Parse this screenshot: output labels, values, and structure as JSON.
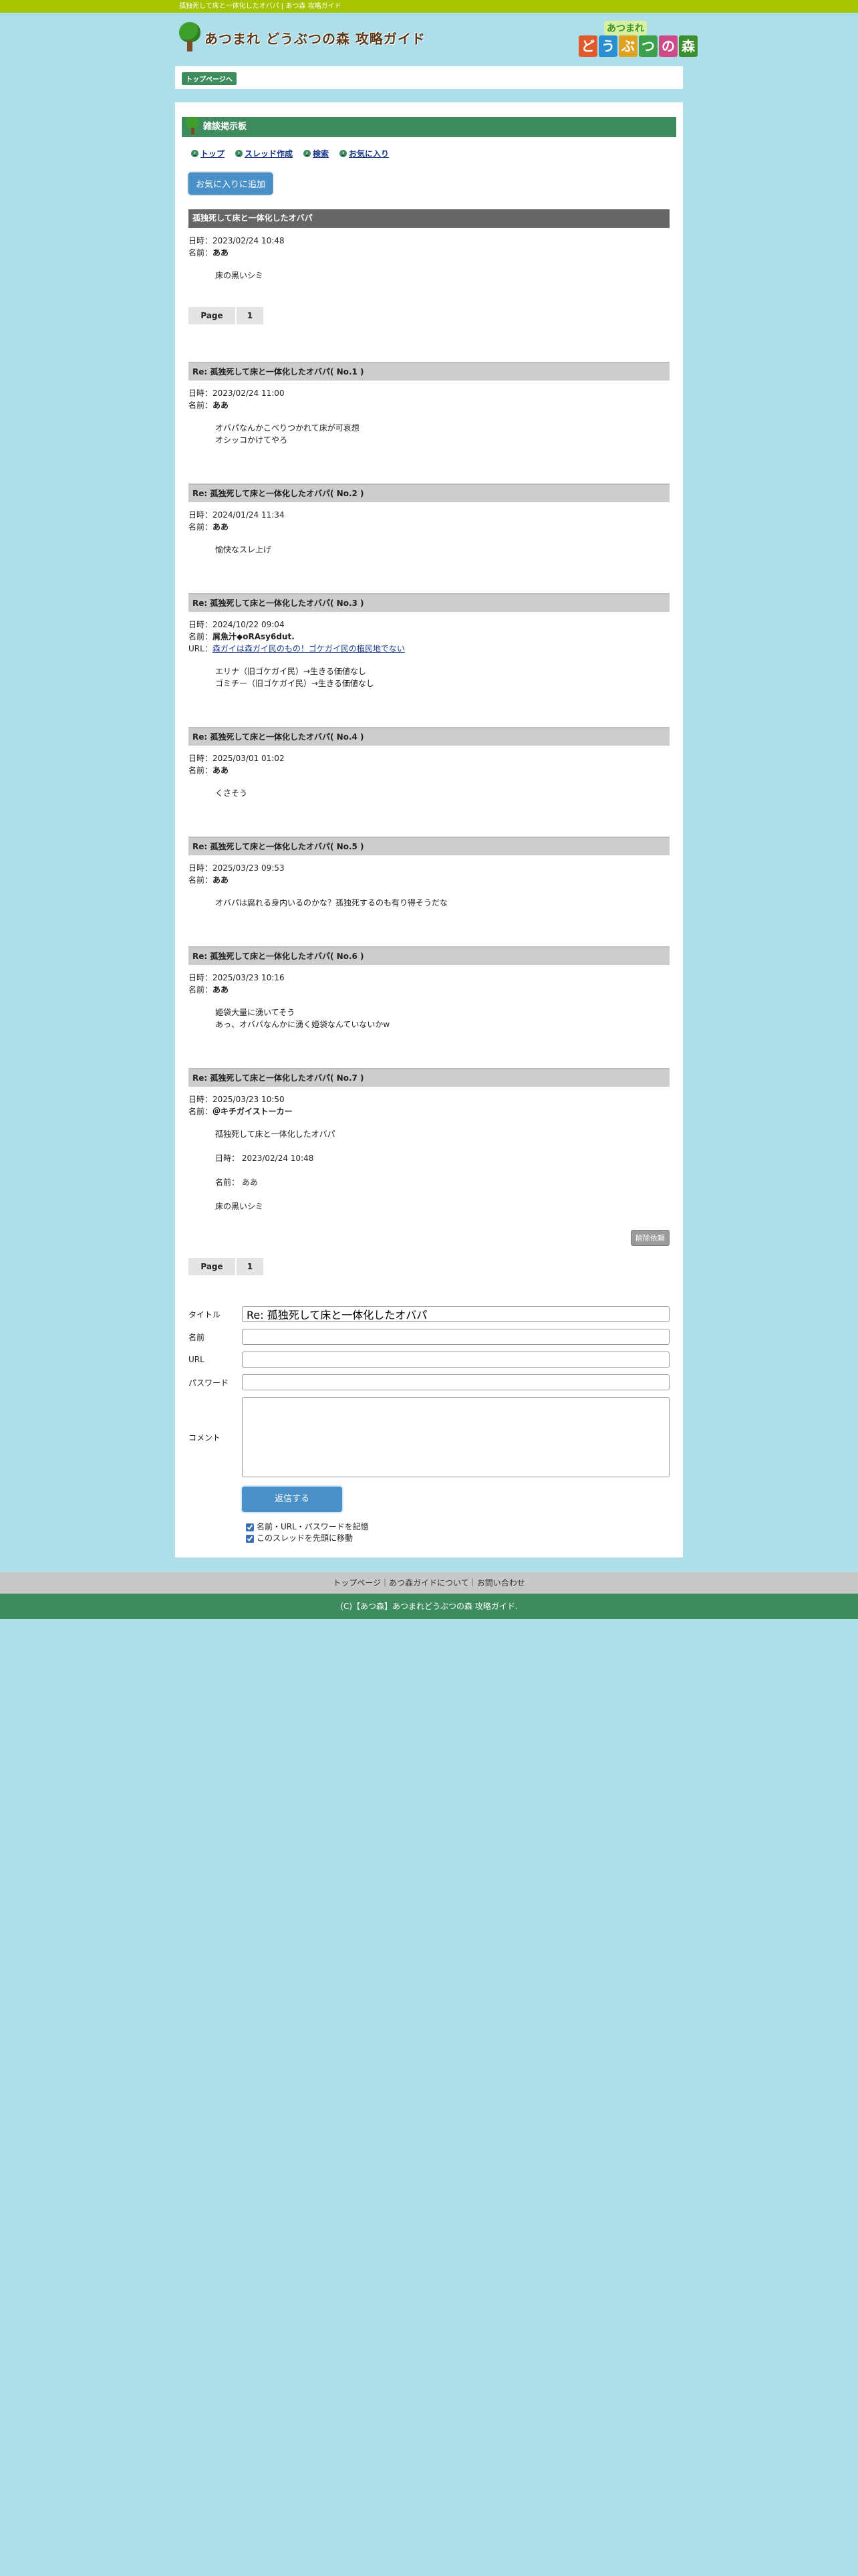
{
  "topbar": {
    "title": "孤独死して床と一体化したオバパ | あつ森 攻略ガイド"
  },
  "header": {
    "logo_text": "あつまれ どうぶつの森 攻略ガイド",
    "logo2_small": "あつまれ",
    "logo2_tiles": [
      "ど",
      "う",
      "ぶ",
      "つ",
      "の",
      "森"
    ]
  },
  "breadcrumb": {
    "home": "トップページへ"
  },
  "board": {
    "title": "雑談掲示板"
  },
  "nav": {
    "top": "トップ",
    "new_thread": "スレッド作成",
    "search": "検索",
    "favorites": "お気に入り"
  },
  "fav_button": "お気に入りに追加",
  "labels": {
    "date": "日時：",
    "name": "名前：",
    "url": "URL：",
    "page": "Page",
    "delete": "削除依頼"
  },
  "original": {
    "title": "孤独死して床と一体化したオバパ",
    "date": "2023/02/24 10:48",
    "name": "ああ",
    "body": "床の黒いシミ"
  },
  "pager_top": {
    "label": "Page",
    "num": "1"
  },
  "replies": [
    {
      "title": "Re: 孤独死して床と一体化したオバパ( No.1 )",
      "date": "2023/02/24 11:00",
      "name": "ああ",
      "body": [
        "オバパなんかこべりつかれて床が可哀想",
        "オシッコかけてやろ"
      ]
    },
    {
      "title": "Re: 孤独死して床と一体化したオバパ( No.2 )",
      "date": "2024/01/24 11:34",
      "name": "ああ",
      "body": [
        "愉快なスレ上げ"
      ]
    },
    {
      "title": "Re: 孤独死して床と一体化したオバパ( No.3 )",
      "date": "2024/10/22 09:04",
      "name": "屑魚汁◆oRAsy6dut.",
      "url": "森ガイは森ガイ民のもの！ゴケガイ民の植民地でない",
      "body": [
        "エリナ（旧ゴケガイ民）→生きる価値なし",
        "ゴミチー（旧ゴケガイ民）→生きる価値なし"
      ]
    },
    {
      "title": "Re: 孤独死して床と一体化したオバパ( No.4 )",
      "date": "2025/03/01 01:02",
      "name": "ああ",
      "body": [
        "くさそう"
      ]
    },
    {
      "title": "Re: 孤独死して床と一体化したオバパ( No.5 )",
      "date": "2025/03/23 09:53",
      "name": "ああ",
      "body": [
        "オバパは腐れる身内いるのかな？孤独死するのも有り得そうだな"
      ]
    },
    {
      "title": "Re: 孤独死して床と一体化したオバパ( No.6 )",
      "date": "2025/03/23 10:16",
      "name": "ああ",
      "body": [
        "姫袋大量に湧いてそう",
        "あっ、オバパなんかに湧く姫袋なんていないかw"
      ]
    },
    {
      "title": "Re: 孤独死して床と一体化したオバパ( No.7 )",
      "date": "2025/03/23 10:50",
      "name": "＠キチガイストーカー",
      "body": [
        "孤独死して床と一体化したオバパ",
        "",
        "日時： 2023/02/24 10:48",
        "",
        "名前： ああ",
        "",
        "床の黒いシミ"
      ]
    }
  ],
  "pager_bottom": {
    "label": "Page",
    "num": "1"
  },
  "form": {
    "title_label": "タイトル",
    "title_value": "Re: 孤独死して床と一体化したオバパ",
    "name_label": "名前",
    "url_label": "URL",
    "password_label": "パスワード",
    "comment_label": "コメント",
    "submit": "返信する",
    "remember": "名前・URL・パスワードを記憶",
    "move_top": "このスレッドを先頭に移動"
  },
  "footer": {
    "links": "トップページ｜あつ森ガイドについて｜お問い合わせ",
    "copyright": "(C)【あつ森】あつまれどうぶつの森 攻略ガイド."
  },
  "colors": {
    "topbar": "#a6c400",
    "green": "#3e8c5e",
    "bg": "#aedeea",
    "button": "#4a90c8"
  }
}
